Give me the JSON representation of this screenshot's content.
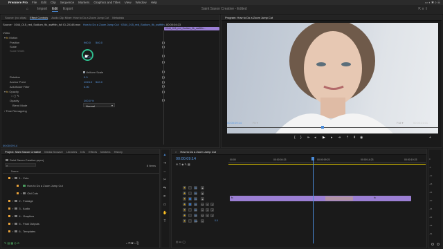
{
  "menubar": {
    "apple": "",
    "app": "Premiere Pro",
    "items": [
      "File",
      "Edit",
      "Clip",
      "Sequence",
      "Markers",
      "Graphics and Titles",
      "View",
      "Window",
      "Help"
    ]
  },
  "header": {
    "home_icon": "home-icon",
    "tabs": [
      "Import",
      "Edit",
      "Export"
    ],
    "active_tab": "Edit",
    "project_title": "Saint Saxon Creative - Edited"
  },
  "source_panel": {
    "tabs": [
      "Source: (no clips)",
      "Effect Controls",
      "Audio Clip Mixer: How to Do a Zoom Jump Cut",
      "Metadata"
    ],
    "active_tab": "Effect Controls",
    "source_line": "Source · 0344_015_red_Sodium_9k_swiftfin_full ID-20148.mov",
    "sequence_link": "How to Do a Zoom Jump Cut · 0344_015_red_Sodium_9k_swiftfin...",
    "clip_bar_label": "0344_015_red_Sodium_9k_swiftfin...",
    "mini_timecode": "00:00:04:23",
    "section_video": "Video",
    "fx_motion": "Motion",
    "rows": {
      "position": "Position",
      "scale": "Scale",
      "scale_width": "Scale Width",
      "uniform_scale": "Uniform Scale",
      "rotation": "Rotation",
      "anchor_point": "Anchor Point",
      "anti_flicker": "Anti-flicker Filter",
      "opacity": "Opacity",
      "opacity_value_label": "Opacity",
      "blend_mode": "Blend Mode",
      "time_remapping": "Time Remapping"
    },
    "values": {
      "position_x": "960.0",
      "position_y": "540.0",
      "scale": "100.0",
      "rotation": "0.0",
      "anchor_x": "1024.0",
      "anchor_y": "540.0",
      "anti_flicker": "0.00",
      "opacity": "100.0 %",
      "blend_mode": "Normal"
    },
    "timecode": "00:00:09:14"
  },
  "program_panel": {
    "title": "Program: How to Do a Zoom Jump Cut",
    "timecode": "00:00:09:14",
    "fit": "Fit",
    "quality": "Full",
    "duration": "00:00:21:01"
  },
  "project_panel": {
    "tabs": [
      "Project: Saint Saxon Creative",
      "Media Browser",
      "Libraries",
      "Info",
      "Effects",
      "Markers",
      "History"
    ],
    "active_tab": "Project: Saint Saxon Creative",
    "file": "Saint Saxon Creative.prproj",
    "item_count": "8 Items",
    "column_name": "Name",
    "bins": [
      {
        "label": "1 - Cuts",
        "indent": 0,
        "color": "#e8a23a",
        "folder": true
      },
      {
        "label": "How to Do a Zoom Jump Cut",
        "indent": 2,
        "color": "#e8a23a",
        "folder": false
      },
      {
        "label": "Old Cuts",
        "indent": 2,
        "color": "#e8a23a",
        "folder": true
      },
      {
        "label": "2 - Footage",
        "indent": 0,
        "color": "#e8a23a",
        "folder": true
      },
      {
        "label": "3 - Audio",
        "indent": 0,
        "color": "#e8a23a",
        "folder": true
      },
      {
        "label": "4 - Graphics",
        "indent": 0,
        "color": "#e8a23a",
        "folder": true
      },
      {
        "label": "5 - Final Outputs",
        "indent": 0,
        "color": "#e8a23a",
        "folder": true
      },
      {
        "label": "6 - Templates",
        "indent": 0,
        "color": "#e8a23a",
        "folder": true
      }
    ]
  },
  "timeline": {
    "tab": "How to Do a Zoom Jump Cut",
    "timecode": "00:00:09:14",
    "ruler": [
      "00:00",
      "00:00:04:23",
      "00:00:09:23",
      "00:00:14:23",
      "00:00:19:23"
    ],
    "tracks": [
      "V3",
      "V2",
      "V1",
      "A1",
      "A2",
      "A3",
      "Mix"
    ],
    "mix_value": "0.0",
    "clip_color": "#9b7fd4",
    "audio_meter_labels": [
      "0",
      "-6",
      "-12",
      "-18",
      "-24",
      "-30",
      "-36",
      "-42",
      "-48",
      "-54"
    ]
  },
  "tools": [
    "selection-tool-icon",
    "track-select-icon",
    "ripple-edit-icon",
    "razor-icon",
    "slip-icon",
    "pen-icon",
    "rectangle-icon",
    "hand-icon",
    "type-icon"
  ]
}
